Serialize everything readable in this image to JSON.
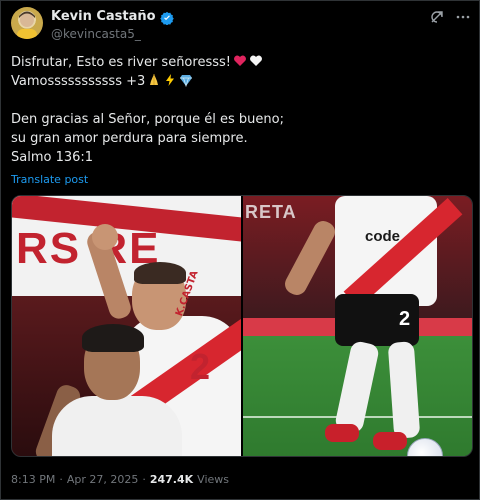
{
  "author": {
    "name": "Kevin Castaño",
    "handle": "@kevincasta5_"
  },
  "icons": {
    "verified": "verified-badge-icon",
    "grok": "grok-icon",
    "more": "more-icon",
    "heart_red": "red-heart-emoji",
    "heart_white": "white-heart-emoji",
    "pray": "folded-hands-emoji",
    "bolt": "high-voltage-emoji",
    "gem": "gem-stone-emoji"
  },
  "colors": {
    "accent": "#1d9bf0",
    "muted": "#71767b",
    "text": "#e7e9ea"
  },
  "tweet": {
    "line1": "Disfrutar, Esto es river señoresss!",
    "line2": "Vamosssssssssss +3",
    "line3": "Den gracias al Señor, porque él es bueno;",
    "line4": "su gran amor perdura para siempre.",
    "line5": "Salmo 136:1"
  },
  "translate_label": "Translate post",
  "media": {
    "left_banner_text": "RS  RE",
    "left_shirt_name": "K.CASTA",
    "left_shirt_number": "2",
    "right_stand_text": "RETA",
    "right_shirt_brand": "code",
    "right_shorts_number": "2"
  },
  "meta": {
    "time": "8:13 PM",
    "sep1": "·",
    "date": "Apr 27, 2025",
    "sep2": "·",
    "views_count": "247.4K",
    "views_label": "Views"
  }
}
